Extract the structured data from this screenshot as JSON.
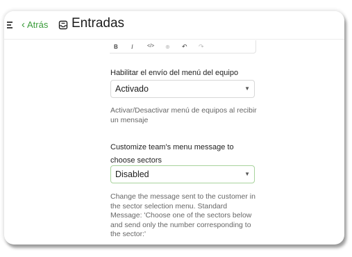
{
  "header": {
    "back_label": "Atrás",
    "title": "Entradas"
  },
  "toolbar": {
    "bold": "B",
    "italic": "I",
    "code": "</>",
    "link": "⊕",
    "undo": "↶",
    "redo": "↷"
  },
  "fields": [
    {
      "label": "Habilitar el envío del menú del equipo",
      "value": "Activado",
      "help": "Activar/Desactivar menú de equipos al recibir un mensaje"
    },
    {
      "label": "Customize team's menu message to choose sectors",
      "value": "Disabled",
      "help": "Change the message sent to the customer in the sector selection menu. Standard Message: 'Choose one of the sectors below and send only the number corresponding to the sector:'"
    }
  ],
  "colors": {
    "accent": "#3a9b3a",
    "focus_border": "#a8d39c"
  }
}
